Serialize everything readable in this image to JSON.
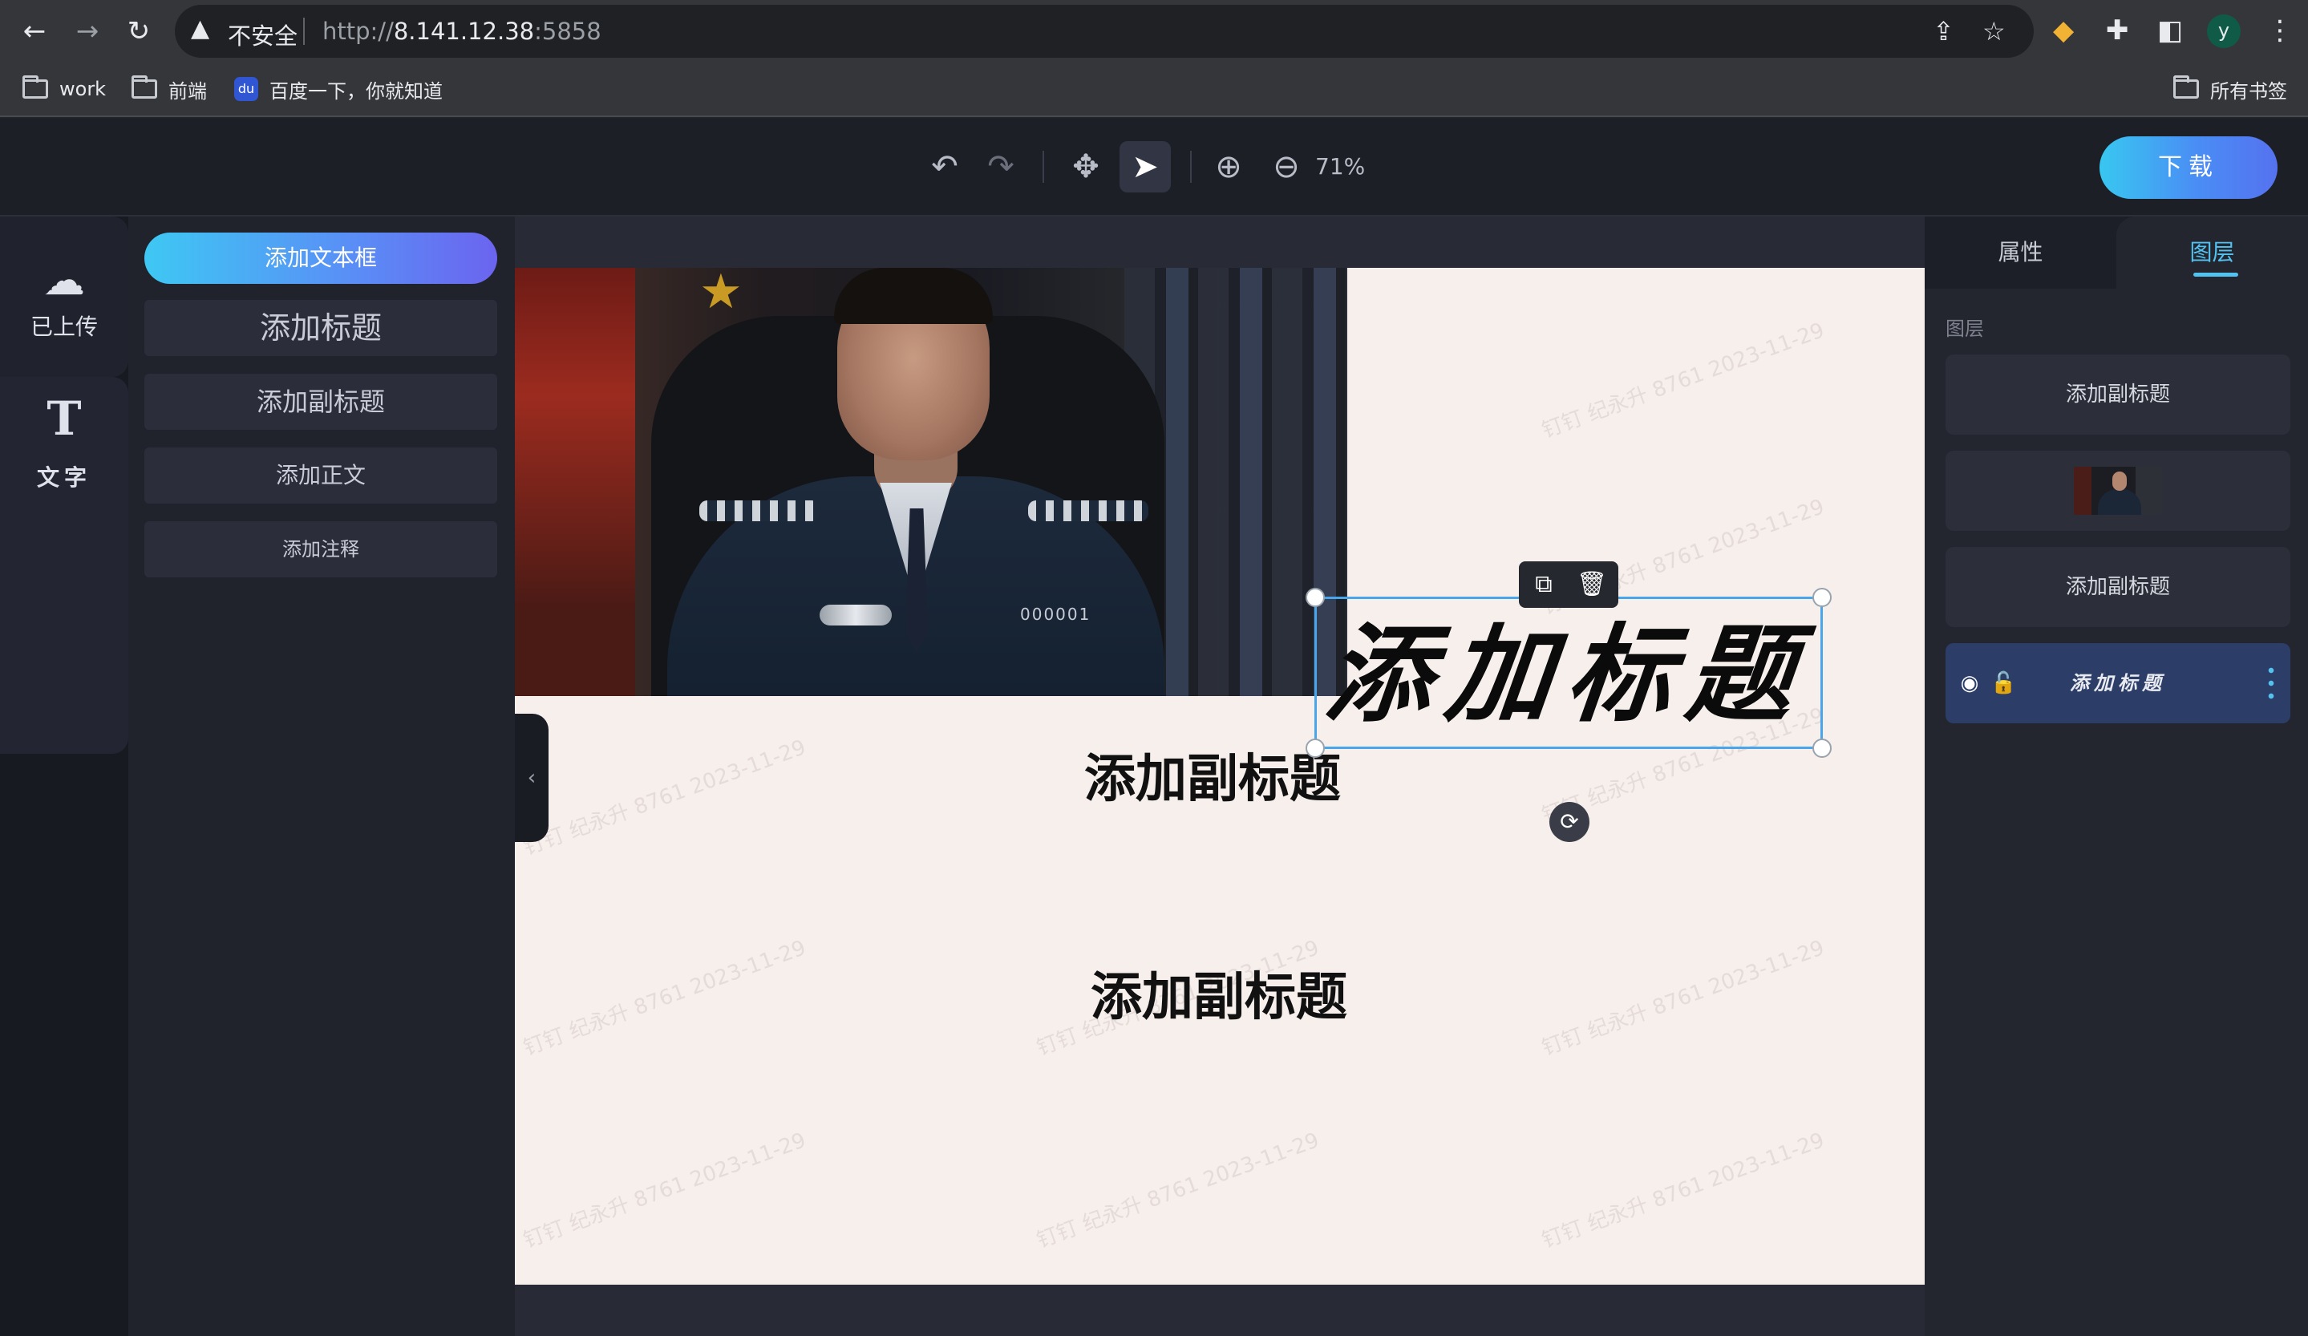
{
  "browser": {
    "security_label": "不安全",
    "url_scheme": "http://",
    "url_host": "8.141.12.38",
    "url_port": ":5858",
    "profile_initial": "y",
    "bookmarks": [
      {
        "label": "work",
        "icon": "folder-icon"
      },
      {
        "label": "前端",
        "icon": "folder-icon"
      },
      {
        "label": "百度一下，你就知道",
        "icon": "baidu-icon"
      }
    ],
    "all_bookmarks_label": "所有书签"
  },
  "toolbar": {
    "zoom_level": "71%",
    "download_label": "下载",
    "tools": [
      "undo-icon",
      "redo-icon",
      "move-icon",
      "select-pointer-icon",
      "zoom-in-icon",
      "zoom-out-icon"
    ]
  },
  "left_rail": {
    "upload_label": "已上传",
    "text_label": "文字",
    "text_glyph": "T"
  },
  "text_panel": {
    "add_textbox": "添加文本框",
    "add_title": "添加标题",
    "add_subtitle": "添加副标题",
    "add_body": "添加正文",
    "add_annotation": "添加注释"
  },
  "canvas": {
    "photo_badge_number": "000001",
    "calligraphy_title": "添加标题",
    "subtitle_1": "添加副标题",
    "subtitle_2": "添加副标题",
    "watermark_text": "钉钉 纪永升 8761 2023-11-29"
  },
  "right_panel": {
    "tab_properties": "属性",
    "tab_layers": "图层",
    "layers_heading": "图层",
    "layers": [
      {
        "label": "添加副标题",
        "type": "text"
      },
      {
        "label": "",
        "type": "image"
      },
      {
        "label": "添加副标题",
        "type": "text"
      },
      {
        "label": "添加标题",
        "type": "text",
        "selected": true
      }
    ]
  },
  "colors": {
    "accent": "#52c2f0",
    "selection": "#4aa6ea",
    "artboard": "#f6efec",
    "download_gradient_start": "#38c7f0",
    "download_gradient_end": "#5572ef"
  }
}
